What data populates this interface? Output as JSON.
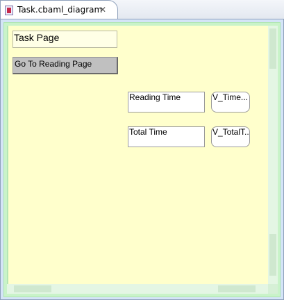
{
  "tab": {
    "title": "Task.cbaml_diagram",
    "icon": "file-icon",
    "close_icon": "close-icon"
  },
  "diagram": {
    "page_title": "Task Page",
    "button_label": "Go To Reading Page",
    "reading_time_label": "Reading Time",
    "time_variable": "V_Time...",
    "total_time_label": "Total Time",
    "total_time_variable": "V_TotalT..."
  },
  "colors": {
    "canvas": "#ffffcc",
    "canvas_border": "#c9f3c9",
    "button": "#c0c0c0"
  }
}
